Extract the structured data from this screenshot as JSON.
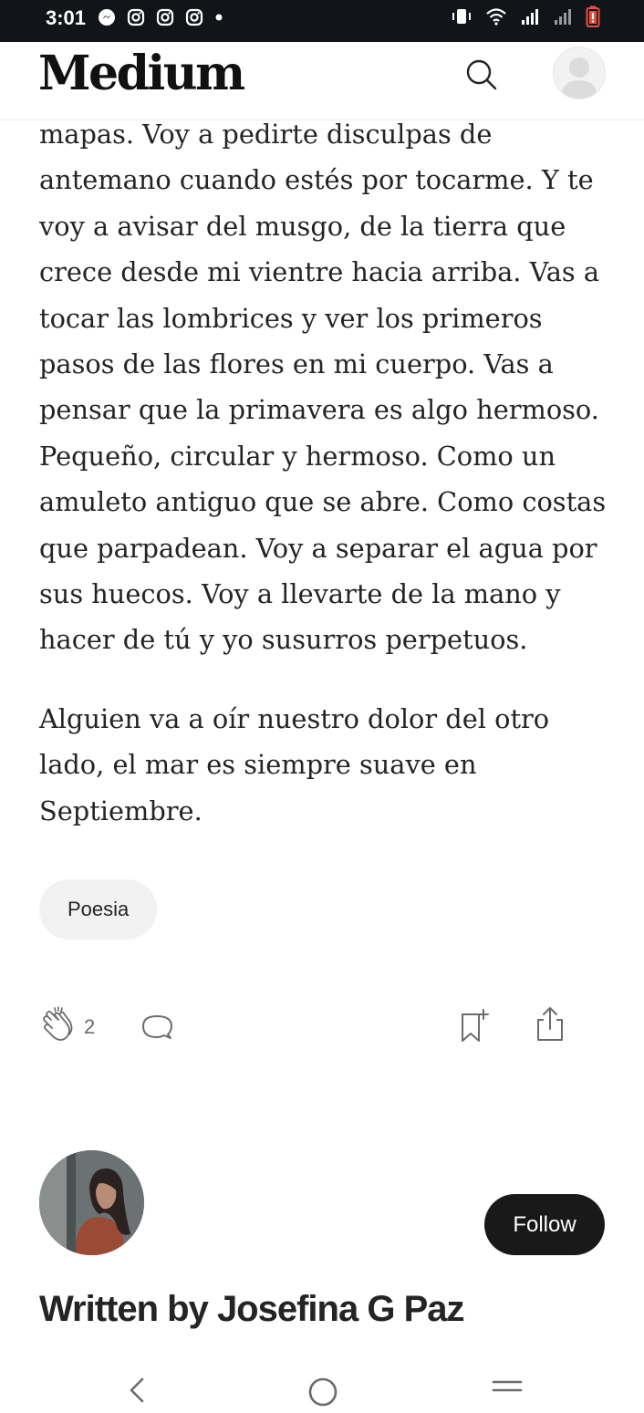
{
  "status_bar": {
    "time": "3:01",
    "left_icons": [
      "messenger-icon",
      "instagram-icon",
      "instagram-icon",
      "instagram-icon",
      "dot-icon"
    ],
    "right_icons": [
      "vibrate-icon",
      "wifi-icon",
      "signal-icon",
      "signal-icon",
      "battery-low-icon"
    ],
    "battery_color": "#e5533d"
  },
  "app_bar": {
    "logo": "Medium"
  },
  "article": {
    "paragraphs": [
      "mapas. Voy a pedirte disculpas de antemano cuando estés por tocarme. Y te voy a avisar del musgo, de la tierra que crece desde mi vientre hacia arriba. Vas a tocar las lombrices y ver los primeros pasos de las flores en mi cuerpo. Vas a pensar que la primavera es algo hermoso. Pequeño, circular y hermoso. Como un amuleto antiguo que se abre. Como costas que parpadean. Voy a separar el agua por sus huecos. Voy a llevarte de la mano y hacer de tú y yo susurros perpetuos.",
      "Alguien va a oír nuestro dolor del otro lado, el mar es siempre suave en Septiembre."
    ]
  },
  "tags": [
    "Poesia"
  ],
  "actions": {
    "clap_count": "2"
  },
  "author": {
    "follow_label": "Follow",
    "written_by": "Written by Josefina G Paz"
  },
  "colors": {
    "text": "#242424",
    "follow_bg": "#191919",
    "tag_bg": "#f2f2f2",
    "status_bar_bg": "#111418"
  }
}
